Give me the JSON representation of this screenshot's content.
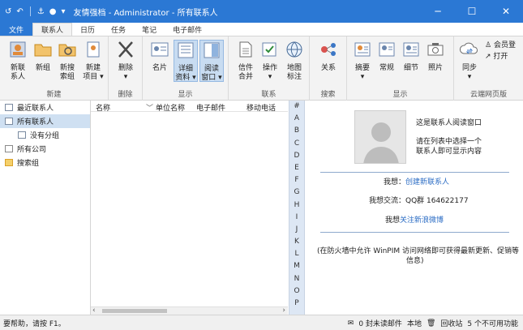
{
  "window": {
    "title": "友情强档 - Administrator - 所有联系人",
    "controls": [
      "─",
      "☐",
      "✕"
    ]
  },
  "tabs": [
    "文件",
    "联系人",
    "日历",
    "任务",
    "笔记",
    "电子邮件"
  ],
  "ribbon": {
    "groups": {
      "new": "新建",
      "delete": "删除",
      "view": "显示",
      "contact": "联系",
      "search": "搜索",
      "display": "显示",
      "cloud": "云端网页版"
    },
    "buttons": {
      "new_contact": "新联\n系人",
      "new_group": "新组",
      "new_search_group": "新搜\n索组",
      "new_item": "新建\n项目 ▾",
      "delete": "删除\n▾",
      "card": "名片",
      "detail": "详细\n资料 ▾",
      "reading_pane": "阅读\n窗口 ▾",
      "mail_merge": "信件\n合并",
      "action": "操作\n▾",
      "map": "地图\n标注",
      "relation": "关系",
      "summary": "摘要\n▾",
      "normal": "常规",
      "detail2": "细节",
      "photo": "照片",
      "sync": "同步\n▾",
      "member": "会员登",
      "open": "打开"
    }
  },
  "nav": {
    "recent": "最近联系人",
    "all": "所有联系人",
    "no_group": "没有分组",
    "all_companies": "所有公司",
    "search_group": "搜索组"
  },
  "list": {
    "headers": [
      "名称",
      "单位名称",
      "电子邮件",
      "移动电话"
    ]
  },
  "alpha": [
    "#",
    "A",
    "B",
    "C",
    "D",
    "E",
    "F",
    "G",
    "H",
    "I",
    "J",
    "K",
    "L",
    "M",
    "N",
    "O",
    "P"
  ],
  "reading": {
    "caption": "这是联系人阅读窗口",
    "hint_line1": "请在列表中选择一个",
    "hint_line2": "联系人即可显示内容",
    "want_label": "我想：",
    "want_link": "创建新联系人",
    "exchange": "我想交流：QQ群 164622177",
    "follow_label": "我想",
    "follow_link": "关注新浪微博",
    "firewall_line1": "(在防火墙中允许 WinPIM 访问网络即可获得最新更新、促销等",
    "firewall_line2": "信息)"
  },
  "status": {
    "help": "要帮助，请按 F1。",
    "unread": "0 封未读邮件",
    "local": "本地",
    "recycle": "回收站",
    "functions": "5 个不可用功能"
  }
}
